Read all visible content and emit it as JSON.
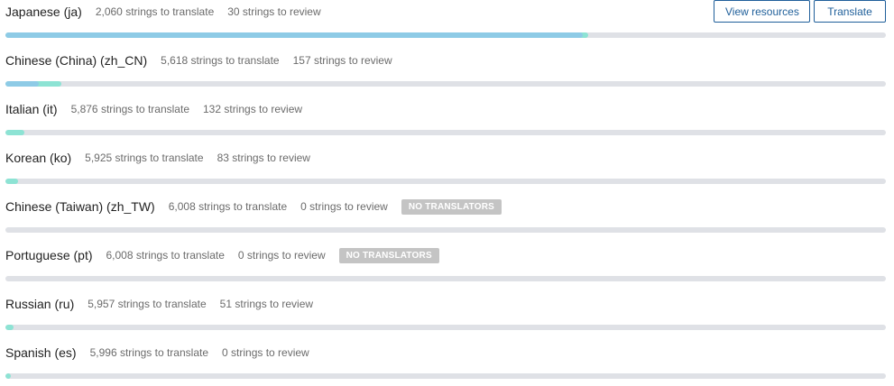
{
  "actions": {
    "view_resources_label": "View resources",
    "translate_label": "Translate"
  },
  "colors": {
    "translated": "#8ecbe6",
    "reviewed": "#8de3d4",
    "track": "#dfe1e6",
    "badge": "#c4c4c4",
    "button": "#1f5f9a"
  },
  "languages": [
    {
      "name": "Japanese (ja)",
      "to_translate": "2,060 strings to translate",
      "to_review": "30 strings to review",
      "badge": "",
      "translated_fraction": 0.656,
      "reviewed_fraction": 0.662
    },
    {
      "name": "Chinese (China) (zh_CN)",
      "to_translate": "5,618 strings to translate",
      "to_review": "157 strings to review",
      "badge": "",
      "translated_fraction": 0.038,
      "reviewed_fraction": 0.064
    },
    {
      "name": "Italian (it)",
      "to_translate": "5,876 strings to translate",
      "to_review": "132 strings to review",
      "badge": "",
      "translated_fraction": 0.0,
      "reviewed_fraction": 0.022
    },
    {
      "name": "Korean (ko)",
      "to_translate": "5,925 strings to translate",
      "to_review": "83 strings to review",
      "badge": "",
      "translated_fraction": 0.0,
      "reviewed_fraction": 0.014
    },
    {
      "name": "Chinese (Taiwan) (zh_TW)",
      "to_translate": "6,008 strings to translate",
      "to_review": "0 strings to review",
      "badge": "NO TRANSLATORS",
      "translated_fraction": 0.0,
      "reviewed_fraction": 0.0
    },
    {
      "name": "Portuguese (pt)",
      "to_translate": "6,008 strings to translate",
      "to_review": "0 strings to review",
      "badge": "NO TRANSLATORS",
      "translated_fraction": 0.0,
      "reviewed_fraction": 0.0
    },
    {
      "name": "Russian (ru)",
      "to_translate": "5,957 strings to translate",
      "to_review": "51 strings to review",
      "badge": "",
      "translated_fraction": 0.0,
      "reviewed_fraction": 0.009
    },
    {
      "name": "Spanish (es)",
      "to_translate": "5,996 strings to translate",
      "to_review": "0 strings to review",
      "badge": "",
      "translated_fraction": 0.0,
      "reviewed_fraction": 0.002
    }
  ]
}
